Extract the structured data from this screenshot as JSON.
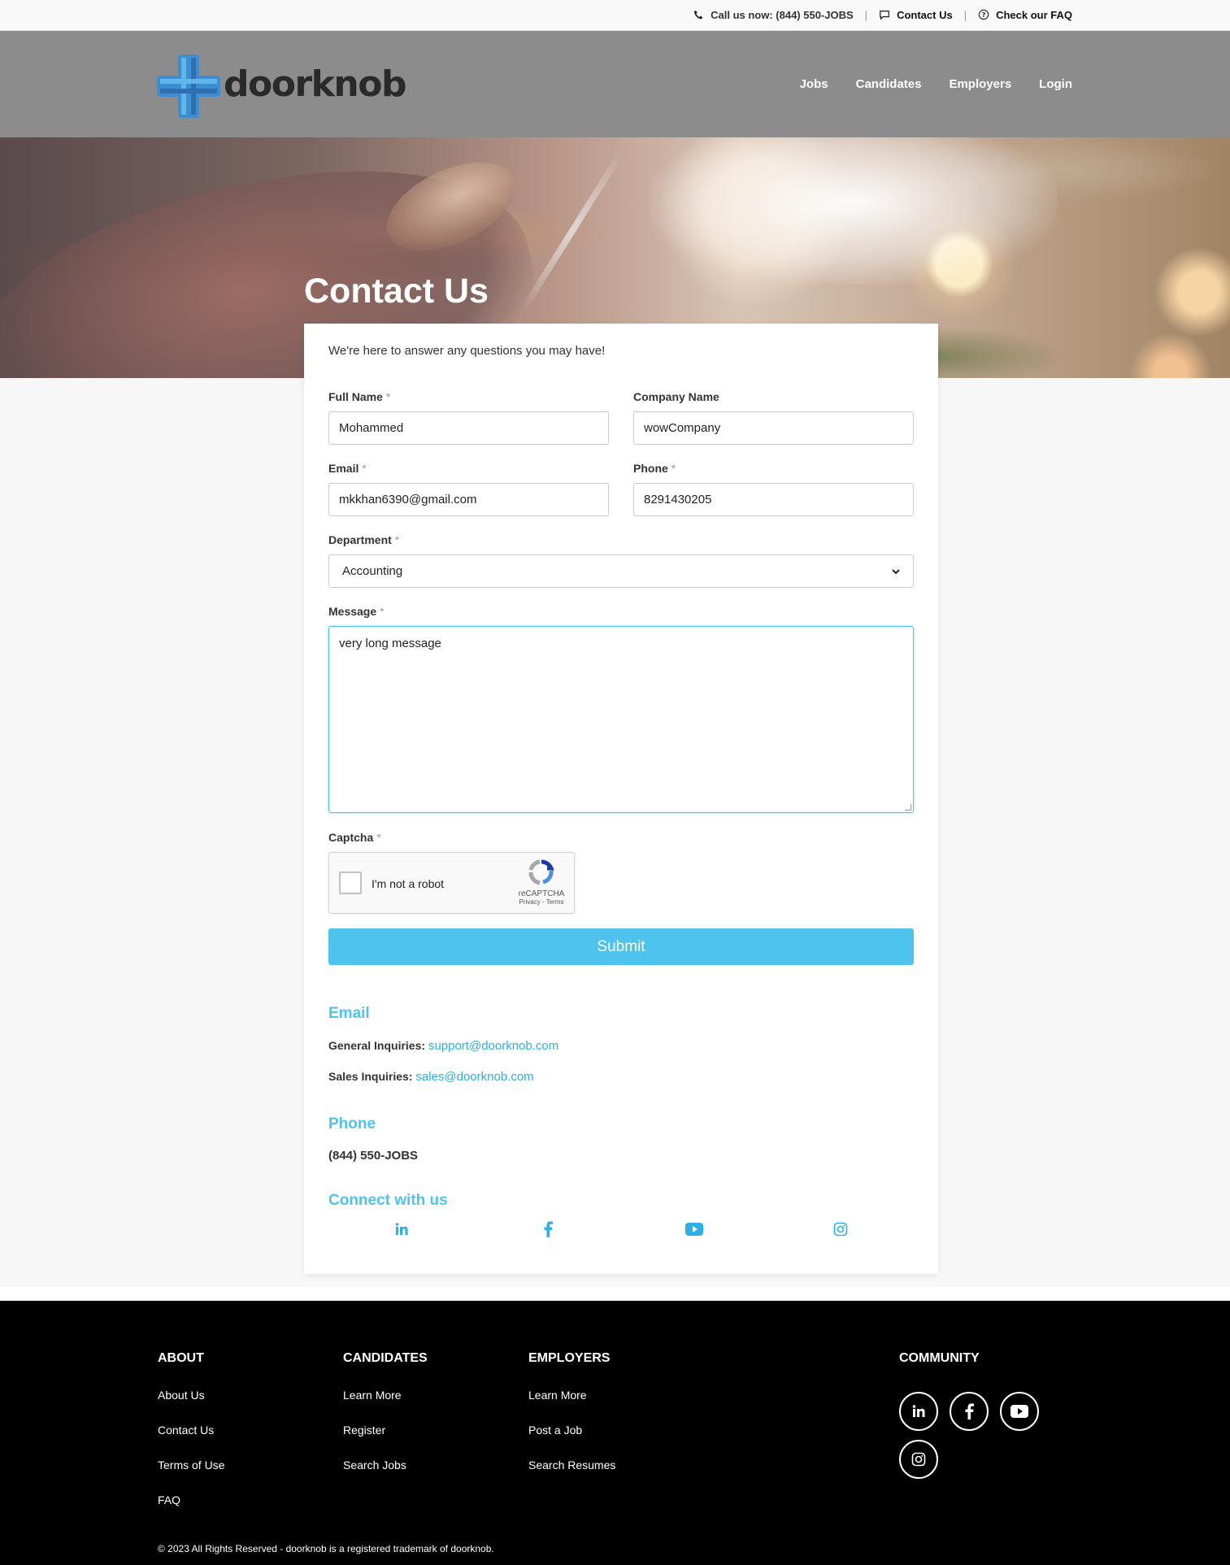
{
  "topbar": {
    "call_label": "Call us now: (844) 550-JOBS",
    "contact_label": "Contact Us",
    "faq_label": "Check our FAQ",
    "separator": "|"
  },
  "header": {
    "logo_text": "doorknob",
    "nav": [
      "Jobs",
      "Candidates",
      "Employers",
      "Login"
    ]
  },
  "hero": {
    "title": "Contact Us"
  },
  "form": {
    "intro": "We're here to answer any questions you may have!",
    "required_mark": "*",
    "full_name": {
      "label": "Full Name",
      "value": "Mohammed"
    },
    "company_name": {
      "label": "Company Name",
      "value": "wowCompany"
    },
    "email": {
      "label": "Email",
      "value": "mkkhan6390@gmail.com"
    },
    "phone": {
      "label": "Phone",
      "value": "8291430205"
    },
    "department": {
      "label": "Department",
      "value": "Accounting"
    },
    "message": {
      "label": "Message",
      "value": "very long message"
    },
    "captcha": {
      "label": "Captcha",
      "checkbox_label": "I'm not a robot",
      "brand": "reCAPTCHA",
      "links": "Privacy - Terms"
    },
    "submit_label": "Submit"
  },
  "contact_info": {
    "email_heading": "Email",
    "general_label": "General Inquiries:",
    "general_email": "support@doorknob.com",
    "sales_label": "Sales Inquiries:",
    "sales_email": "sales@doorknob.com",
    "phone_heading": "Phone",
    "phone_value": "(844) 550-JOBS",
    "connect_heading": "Connect with us",
    "social_icons": [
      "linkedin-icon",
      "facebook-icon",
      "youtube-icon",
      "instagram-icon"
    ]
  },
  "footer": {
    "about": {
      "heading": "ABOUT",
      "links": [
        "About Us",
        "Contact Us",
        "Terms of Use",
        "FAQ"
      ]
    },
    "candidates": {
      "heading": "CANDIDATES",
      "links": [
        "Learn More",
        "Register",
        "Search Jobs"
      ]
    },
    "employers": {
      "heading": "EMPLOYERS",
      "links": [
        "Learn More",
        "Post a Job",
        "Search Resumes"
      ]
    },
    "community": {
      "heading": "COMMUNITY",
      "icons": [
        "linkedin-icon",
        "facebook-icon",
        "youtube-icon",
        "instagram-icon"
      ]
    },
    "copyright": "© 2023 All Rights Reserved - doorknob is a registered trademark of doorknob."
  },
  "colors": {
    "accent": "#4ec3ee",
    "header_bg": "#8c8c8c",
    "footer_bg": "#000000"
  }
}
